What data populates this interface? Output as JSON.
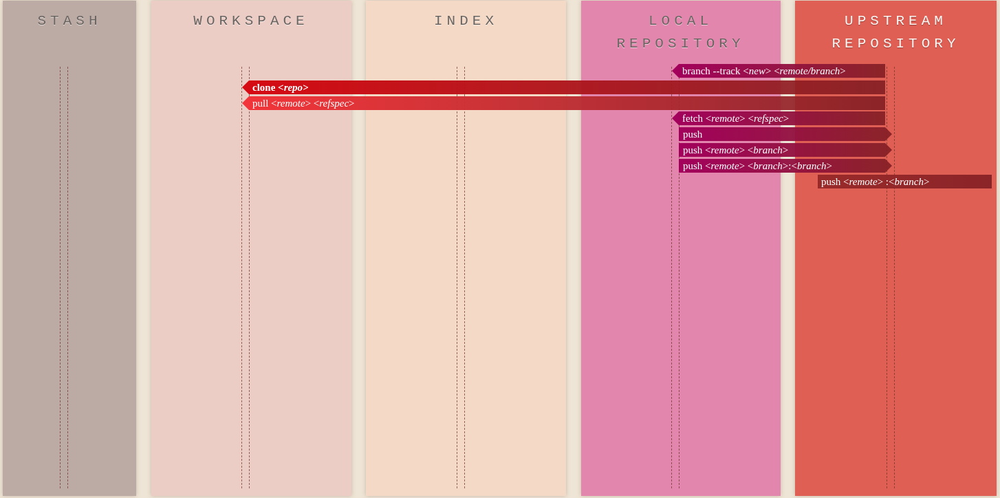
{
  "columns": [
    {
      "title": "STASH",
      "color": "#bcaaa4"
    },
    {
      "title": "WORKSPACE",
      "color": "#eccdc6"
    },
    {
      "title": "INDEX",
      "color": "#f3d9c6"
    },
    {
      "title": "LOCAL REPOSITORY",
      "color": "#e286ae"
    },
    {
      "title": "UPSTREAM REPOSITORY",
      "color": "#e05f55"
    }
  ],
  "commands": [
    {
      "text": "branch --track <*new*> <*remote/branch*>",
      "kind": "incoming",
      "bold": false,
      "color": "#a3005c"
    },
    {
      "text": "clone <*repo*>",
      "kind": "incoming",
      "bold": true,
      "color": "#d60a12"
    },
    {
      "text": "pull <*remote*> <*refspec*>",
      "kind": "incoming",
      "bold": false,
      "color": "#f2353a"
    },
    {
      "text": "fetch <*remote*> <*refspec*>",
      "kind": "incoming",
      "bold": false,
      "color": "#a3005c"
    },
    {
      "text": "push",
      "kind": "outgoing",
      "bold": false,
      "color": "#a3005c"
    },
    {
      "text": "push <*remote*> <*branch*>",
      "kind": "outgoing",
      "bold": false,
      "color": "#a3005c"
    },
    {
      "text": "push <*remote*> <*branch*>:<*branch*>",
      "kind": "outgoing",
      "bold": false,
      "color": "#a3005c"
    },
    {
      "text": "push <*remote*> :<*branch*>",
      "kind": "plain",
      "bold": false,
      "color": "#9a2a2a"
    }
  ]
}
